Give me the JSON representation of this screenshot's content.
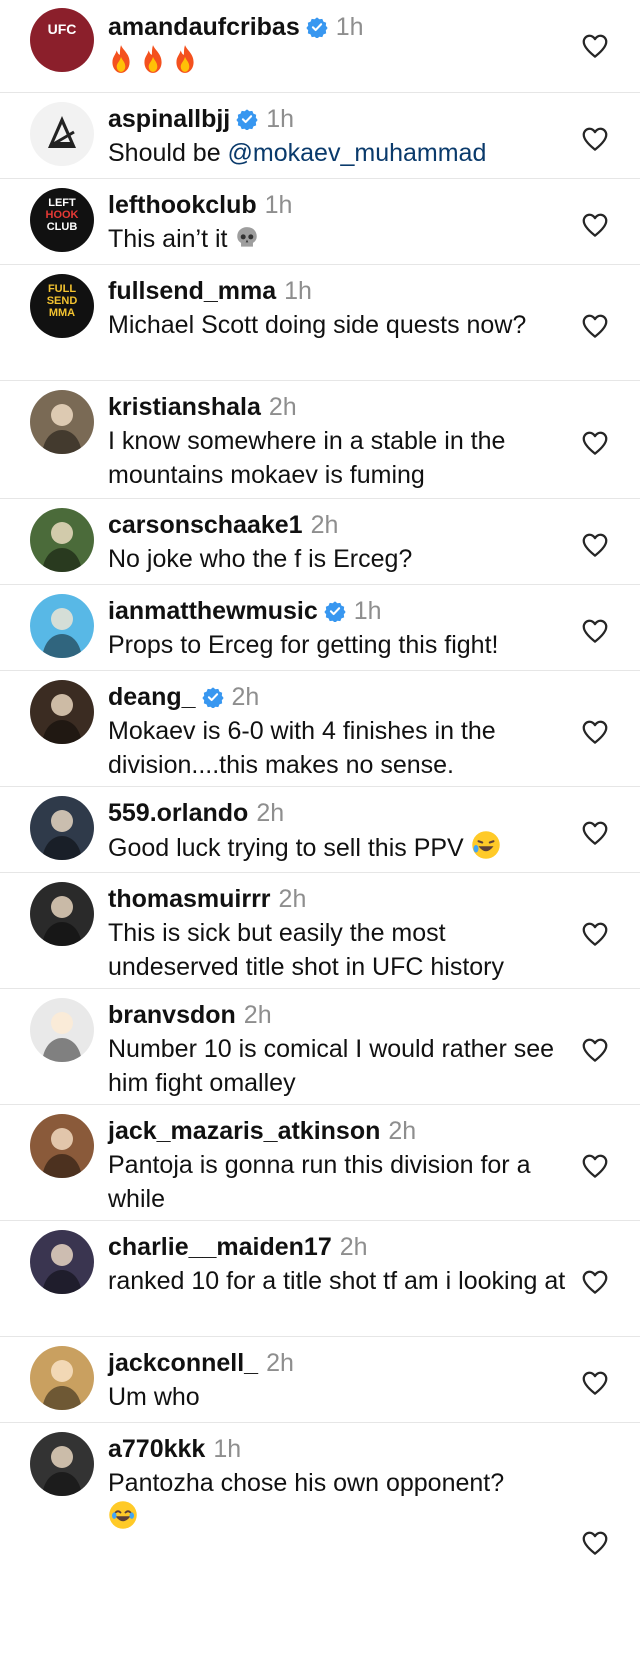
{
  "comments": [
    {
      "username": "amandaufcribas",
      "verified": true,
      "time": "1h",
      "text": "",
      "emoji_tail": "fire x3",
      "avatar_bg": "#8b1f2b",
      "avatar_label": "UFC"
    },
    {
      "username": "aspinallbjj",
      "verified": true,
      "time": "1h",
      "text": "Should be ",
      "mention": "@mokaev_muhammad",
      "avatar_bg": "#f2f2f2",
      "avatar_label": ""
    },
    {
      "username": "lefthookclub",
      "verified": false,
      "time": "1h",
      "text": "This ain’t it ",
      "emoji_tail": "skull",
      "avatar_bg": "#111111",
      "avatar_label": "LEFT HOOK CLUB"
    },
    {
      "username": "fullsend_mma",
      "verified": false,
      "time": "1h",
      "text": "Michael Scott doing side quests now?",
      "avatar_bg": "#111111",
      "avatar_label": "FULL SEND MMA"
    },
    {
      "username": "kristianshala",
      "verified": false,
      "time": "2h",
      "text": "I know somewhere in a stable in the mountains mokaev is fuming",
      "avatar_bg": "#7a6a55",
      "avatar_label": ""
    },
    {
      "username": "carsonschaake1",
      "verified": false,
      "time": "2h",
      "text": "No joke who the f is Erceg?",
      "avatar_bg": "#4b6b3a",
      "avatar_label": ""
    },
    {
      "username": "ianmatthewmusic",
      "verified": true,
      "time": "1h",
      "text": "Props to Erceg for getting this fight!",
      "avatar_bg": "#58b8e6",
      "avatar_label": ""
    },
    {
      "username": "deang_",
      "verified": true,
      "time": "2h",
      "text": "Mokaev is 6-0 with 4 finishes in the division....this makes no sense.",
      "avatar_bg": "#3b2c22",
      "avatar_label": ""
    },
    {
      "username": "559.orlando",
      "verified": false,
      "time": "2h",
      "text": "Good luck trying to sell this PPV ",
      "emoji_tail": "rofl",
      "avatar_bg": "#2f3a4a",
      "avatar_label": ""
    },
    {
      "username": "thomasmuirrr",
      "verified": false,
      "time": "2h",
      "text": "This is sick but easily the most undeserved title shot in UFC history",
      "avatar_bg": "#2a2a2a",
      "avatar_label": ""
    },
    {
      "username": "branvsdon",
      "verified": false,
      "time": "2h",
      "text": "Number 10 is comical I would rather see him fight omalley",
      "avatar_bg": "#e9e9e9",
      "avatar_label": ""
    },
    {
      "username": "jack_mazaris_atkinson",
      "verified": false,
      "time": "2h",
      "text": "Pantoja is gonna run this division for a while",
      "avatar_bg": "#8a5a3a",
      "avatar_label": ""
    },
    {
      "username": "charlie__maiden17",
      "verified": false,
      "time": "2h",
      "text": "ranked 10 for a title shot tf am i looking at",
      "avatar_bg": "#3a3550",
      "avatar_label": ""
    },
    {
      "username": "jackconnell_",
      "verified": false,
      "time": "2h",
      "text": "Um who",
      "avatar_bg": "#c9a060",
      "avatar_label": ""
    },
    {
      "username": "a770kkk",
      "verified": false,
      "time": "1h",
      "text": "Pantozha chose his own opponent?",
      "emoji_tail": "joy",
      "avatar_bg": "#333333",
      "avatar_label": ""
    }
  ],
  "colors": {
    "verified": "#3897f0",
    "time": "#8e8e8e",
    "heart_stroke": "#262626"
  },
  "icons": {
    "heart": "heart-outline-icon",
    "verified": "verified-badge-icon"
  }
}
